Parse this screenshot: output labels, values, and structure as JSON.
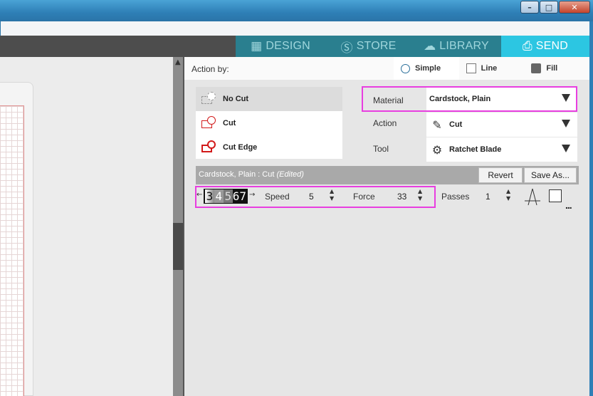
{
  "window": {
    "minimize_icon": "minimize-icon",
    "maximize_icon": "maximize-icon",
    "close_icon": "close-icon"
  },
  "nav": {
    "tabs": [
      {
        "label": "DESIGN",
        "icon": "grid-icon",
        "active": false
      },
      {
        "label": "STORE",
        "icon": "store-s-icon",
        "active": false
      },
      {
        "label": "LIBRARY",
        "icon": "cloud-download-icon",
        "active": false
      },
      {
        "label": "SEND",
        "icon": "cutter-icon",
        "active": true
      }
    ],
    "colors": {
      "bar": "#2a7f8f",
      "active": "#2cc6e2"
    }
  },
  "action_by": {
    "label": "Action by:",
    "modes": [
      {
        "label": "Simple",
        "icon": "radio-icon",
        "selected": true
      },
      {
        "label": "Line",
        "icon": "line-icon",
        "selected": false
      },
      {
        "label": "Fill",
        "icon": "fill-icon",
        "selected": false
      }
    ]
  },
  "cut_options": [
    {
      "label": "No Cut",
      "icon": "no-cut-icon",
      "selected": true
    },
    {
      "label": "Cut",
      "icon": "cut-icon",
      "selected": false
    },
    {
      "label": "Cut Edge",
      "icon": "cut-edge-icon",
      "selected": false
    }
  ],
  "properties": {
    "material": {
      "label": "Material",
      "value": "Cardstock, Plain"
    },
    "action": {
      "label": "Action",
      "value": "Cut",
      "icon": "blade-pen-icon"
    },
    "tool": {
      "label": "Tool",
      "value": "Ratchet Blade",
      "icon": "ratchet-blade-icon"
    }
  },
  "preset": {
    "title": "Cardstock, Plain : Cut",
    "edited": "(Edited)",
    "revert_label": "Revert",
    "save_as_label": "Save As..."
  },
  "settings": {
    "blade_digits": [
      "3",
      "4",
      "5",
      "6",
      "7"
    ],
    "blade_left_arrow": "←",
    "blade_right_arrow": "→",
    "speed": {
      "label": "Speed",
      "value": "5"
    },
    "force": {
      "label": "Force",
      "value": "33"
    },
    "passes": {
      "label": "Passes",
      "value": "1"
    },
    "more": "..."
  },
  "highlight_color": "#e83ee0"
}
